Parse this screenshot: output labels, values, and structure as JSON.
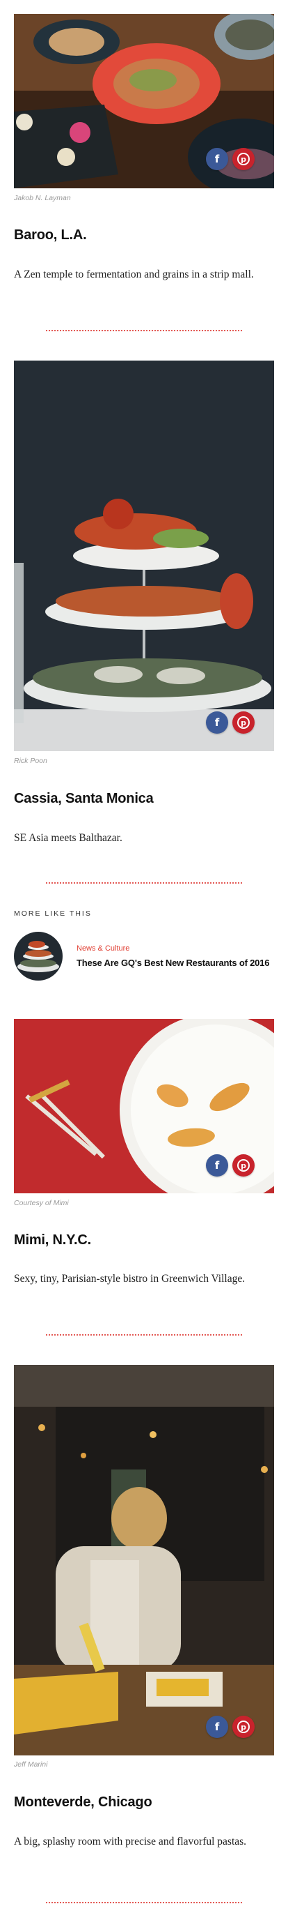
{
  "restaurants": [
    {
      "photo_credit": "Jakob N. Layman",
      "name": "Baroo, L.A.",
      "description": "A Zen temple to fermentation and grains in a strip mall."
    },
    {
      "photo_credit": "Rick Poon",
      "name": "Cassia, Santa Monica",
      "description": "SE Asia meets Balthazar."
    },
    {
      "photo_credit": "Courtesy of Mimi",
      "name": "Mimi, N.Y.C.",
      "description": "Sexy, tiny, Parisian-style bistro in Greenwich Village."
    },
    {
      "photo_credit": "Jeff Marini",
      "name": "Monteverde, Chicago",
      "description": "A big, splashy room with precise and flavorful pastas."
    }
  ],
  "share": {
    "facebook_glyph": "f",
    "pinterest_glyph": "p",
    "facebook_icon": "facebook-icon",
    "pinterest_icon": "pinterest-icon",
    "facebook_color": "#3b5998",
    "pinterest_color": "#c8232c"
  },
  "more_like_this": {
    "label": "MORE LIKE THIS",
    "category": "News & Culture",
    "headline": "These Are GQ's Best New Restaurants of 2016"
  },
  "colors": {
    "accent_red": "#e03b2f",
    "divider": "#e35a55"
  }
}
